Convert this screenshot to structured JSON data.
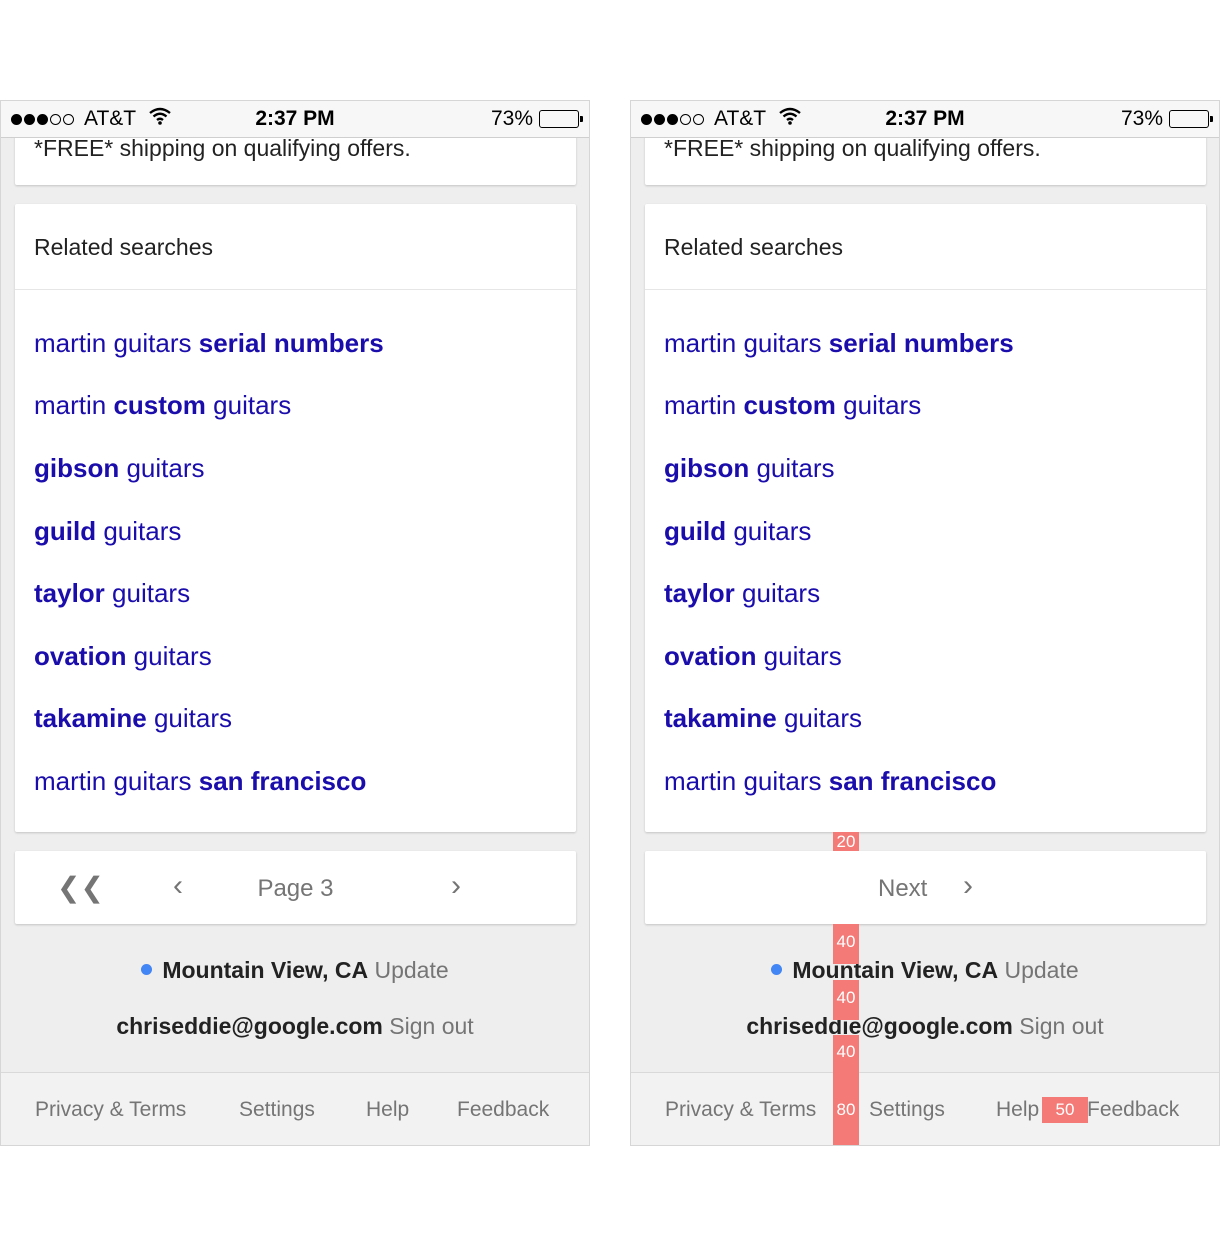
{
  "status_bar": {
    "carrier": "AT&T",
    "time": "2:37 PM",
    "battery_percent": "73%",
    "battery_level": 0.73
  },
  "results": {
    "shipping_snippet": "*FREE* shipping on qualifying offers."
  },
  "related_searches": {
    "title": "Related searches",
    "items": [
      {
        "plain": "martin guitars ",
        "bold": "serial numbers",
        "bold_first": false
      },
      {
        "plain1": "martin ",
        "bold": "custom",
        "plain2": " guitars",
        "mid": true
      },
      {
        "bold": "gibson",
        "plain": " guitars",
        "bold_first": true
      },
      {
        "bold": "guild",
        "plain": " guitars",
        "bold_first": true
      },
      {
        "bold": "taylor",
        "plain": " guitars",
        "bold_first": true
      },
      {
        "bold": "ovation",
        "plain": " guitars",
        "bold_first": true
      },
      {
        "bold": "takamine",
        "plain": " guitars",
        "bold_first": true
      },
      {
        "plain": "martin guitars ",
        "bold": "san francisco",
        "bold_first": false
      }
    ]
  },
  "pagination_left": {
    "first_icon": "double-chevron-left-icon",
    "prev_icon": "chevron-left-icon",
    "page_label": "Page 3",
    "next_icon": "chevron-right-icon"
  },
  "pagination_right": {
    "next_label": "Next",
    "next_icon": "chevron-right-icon"
  },
  "location": {
    "city": "Mountain View, CA",
    "update_label": "Update"
  },
  "account": {
    "email": "chriseddie@google.com",
    "signout_label": "Sign out"
  },
  "footer": {
    "links": [
      "Privacy & Terms",
      "Settings",
      "Help",
      "Feedback"
    ]
  },
  "spacing_annotations": {
    "gap_card_nav": "20",
    "gap_nav_location": "40",
    "gap_location_account": "40",
    "gap_account_footer": "40",
    "footer_height": "80",
    "gap_help_feedback": "50"
  },
  "colors": {
    "link_blue": "#1a0dab",
    "annotation_red": "#f47a77",
    "page_gray": "#eeeeee",
    "location_dot": "#4285f4"
  }
}
